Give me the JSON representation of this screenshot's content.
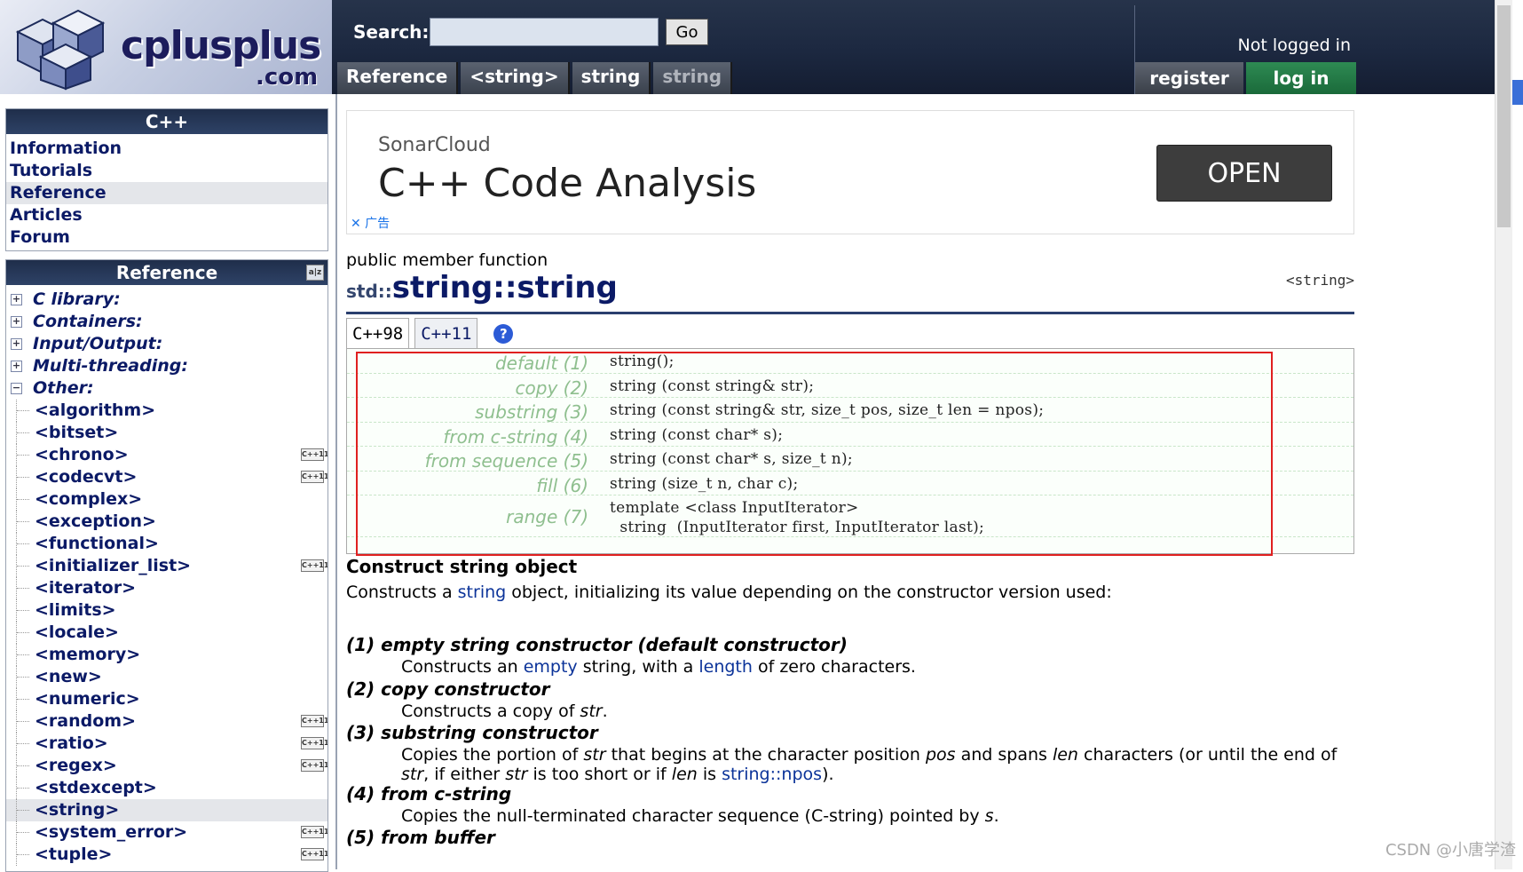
{
  "header": {
    "logo_text": "cplusplus",
    "logo_subtext": ".com",
    "search_label": "Search:",
    "search_value": "",
    "go_label": "Go",
    "breadcrumbs": [
      "Reference",
      "<string>",
      "string",
      "string"
    ],
    "user_status": "Not logged in",
    "register_label": "register",
    "login_label": "log in"
  },
  "sidebar": {
    "cpp_title": "C++",
    "cpp_items": [
      "Information",
      "Tutorials",
      "Reference",
      "Articles",
      "Forum"
    ],
    "cpp_active": "Reference",
    "ref_title": "Reference",
    "categories": [
      {
        "label": "C library:",
        "state": "+"
      },
      {
        "label": "Containers:",
        "state": "+"
      },
      {
        "label": "Input/Output:",
        "state": "+"
      },
      {
        "label": "Multi-threading:",
        "state": "+"
      },
      {
        "label": "Other:",
        "state": "−"
      }
    ],
    "headers": [
      {
        "label": "<algorithm>",
        "badge": ""
      },
      {
        "label": "<bitset>",
        "badge": ""
      },
      {
        "label": "<chrono>",
        "badge": "C++11"
      },
      {
        "label": "<codecvt>",
        "badge": "C++11"
      },
      {
        "label": "<complex>",
        "badge": ""
      },
      {
        "label": "<exception>",
        "badge": ""
      },
      {
        "label": "<functional>",
        "badge": ""
      },
      {
        "label": "<initializer_list>",
        "badge": "C++11"
      },
      {
        "label": "<iterator>",
        "badge": ""
      },
      {
        "label": "<limits>",
        "badge": ""
      },
      {
        "label": "<locale>",
        "badge": ""
      },
      {
        "label": "<memory>",
        "badge": ""
      },
      {
        "label": "<new>",
        "badge": ""
      },
      {
        "label": "<numeric>",
        "badge": ""
      },
      {
        "label": "<random>",
        "badge": "C++11"
      },
      {
        "label": "<ratio>",
        "badge": "C++11"
      },
      {
        "label": "<regex>",
        "badge": "C++11"
      },
      {
        "label": "<stdexcept>",
        "badge": ""
      },
      {
        "label": "<string>",
        "badge": ""
      },
      {
        "label": "<system_error>",
        "badge": "C++11"
      },
      {
        "label": "<tuple>",
        "badge": "C++11"
      }
    ],
    "active_header": "<string>"
  },
  "ad": {
    "sponsor": "SonarCloud",
    "headline": "C++ Code Analysis",
    "button": "OPEN",
    "adchoice": "✕ 广告"
  },
  "main": {
    "member_type": "public member function",
    "title_ns": "std::",
    "title_name": "string::string",
    "header_ref": "<string>",
    "tabs": [
      "C++98",
      "C++11"
    ],
    "help_icon": "?",
    "prototypes": [
      {
        "label": "default (1)",
        "code": "string();"
      },
      {
        "label": "copy (2)",
        "code": "string (const string& str);"
      },
      {
        "label": "substring (3)",
        "code": "string (const string& str, size_t pos, size_t len = npos);"
      },
      {
        "label": "from c-string (4)",
        "code": "string (const char* s);"
      },
      {
        "label": "from sequence (5)",
        "code": "string (const char* s, size_t n);"
      },
      {
        "label": "fill (6)",
        "code": "string (size_t n, char c);"
      },
      {
        "label": "range (7)",
        "code": "template <class InputIterator>",
        "code2": "  string  (InputIterator first, InputIterator last);"
      }
    ],
    "section_title": "Construct string object",
    "intro_a": "Constructs a ",
    "intro_link": "string",
    "intro_b": " object, initializing its value depending on the constructor version used:",
    "defs": [
      {
        "head": "(1) empty string constructor (default constructor)"
      },
      {
        "head": "(2) copy constructor"
      },
      {
        "head": "(3) substring constructor"
      },
      {
        "head": "(4) from c-string"
      },
      {
        "head": "(5) from buffer"
      }
    ]
  },
  "watermark": "CSDN @小唐学渣"
}
